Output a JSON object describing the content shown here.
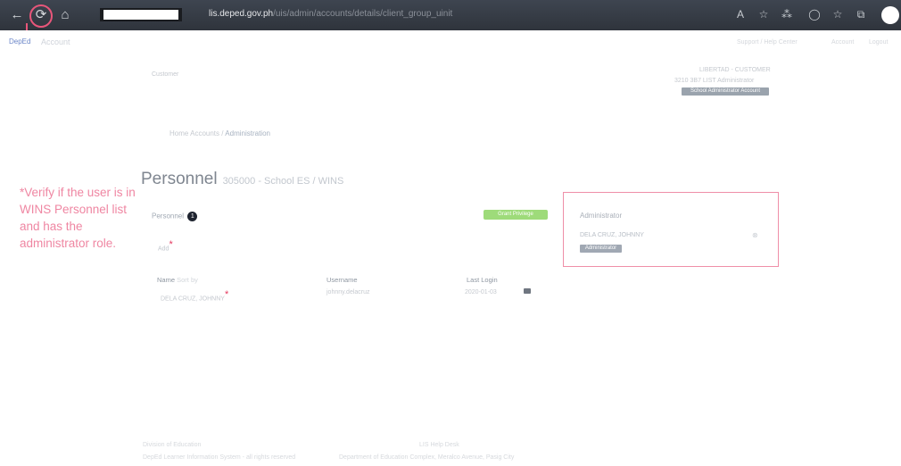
{
  "browser": {
    "url_host": "lis.deped.gov.ph",
    "url_path": "/uis/admin/accounts/details/client_group_uinit",
    "nav_back": "←",
    "nav_reload": "⟳",
    "nav_home": "⌂",
    "toolbar_icons": [
      "A",
      "☆",
      "⁂",
      "◯",
      "☆",
      "⧉"
    ]
  },
  "header": {
    "logo": "DepEd",
    "title": "Account",
    "links": [
      "Support / Help Center",
      "Account",
      "Logout"
    ]
  },
  "school_info": {
    "left_label": "Customer",
    "line1": "LIBERTAD - CUSTOMER",
    "line2": "3210 3B7 LIST Administrator",
    "badge": "School Administrator Account"
  },
  "breadcrumb": {
    "root": "Home Accounts",
    "separator": "/",
    "current": "Administration"
  },
  "page": {
    "title": "Personnel",
    "subtitle": "305000 - School ES / WINS"
  },
  "annotation": "*Verify if the user is in WINS Personnel list and has the administrator role.",
  "personnel": {
    "label": "Personnel",
    "count": "1",
    "add_label": "Add",
    "star": "*",
    "action_button": "Grant Privilege",
    "columns": {
      "name": "Name",
      "name_sort": "Sort by",
      "username": "Username",
      "last_login": "Last Login"
    },
    "rows": [
      {
        "name": "DELA CRUZ, JOHNNY",
        "username": "johnny.delacruz",
        "last_login": "2020-01-03"
      }
    ]
  },
  "admin_panel": {
    "title": "Administrator",
    "name": "DELA CRUZ, JOHNNY",
    "role": "Administrator",
    "remove": "⊗"
  },
  "footer": {
    "heading": "Division of Education",
    "line1": "DepEd Learner Information System - all rights reserved",
    "line2": "LIS Help Desk",
    "line3": "Department of Education Complex, Meralco Avenue, Pasig City"
  },
  "colors": {
    "annotation": "#ef86a2",
    "highlight_box": "#ef8fa8",
    "grant_button": "#9edb7a",
    "browser_bar": "#2f343c"
  }
}
